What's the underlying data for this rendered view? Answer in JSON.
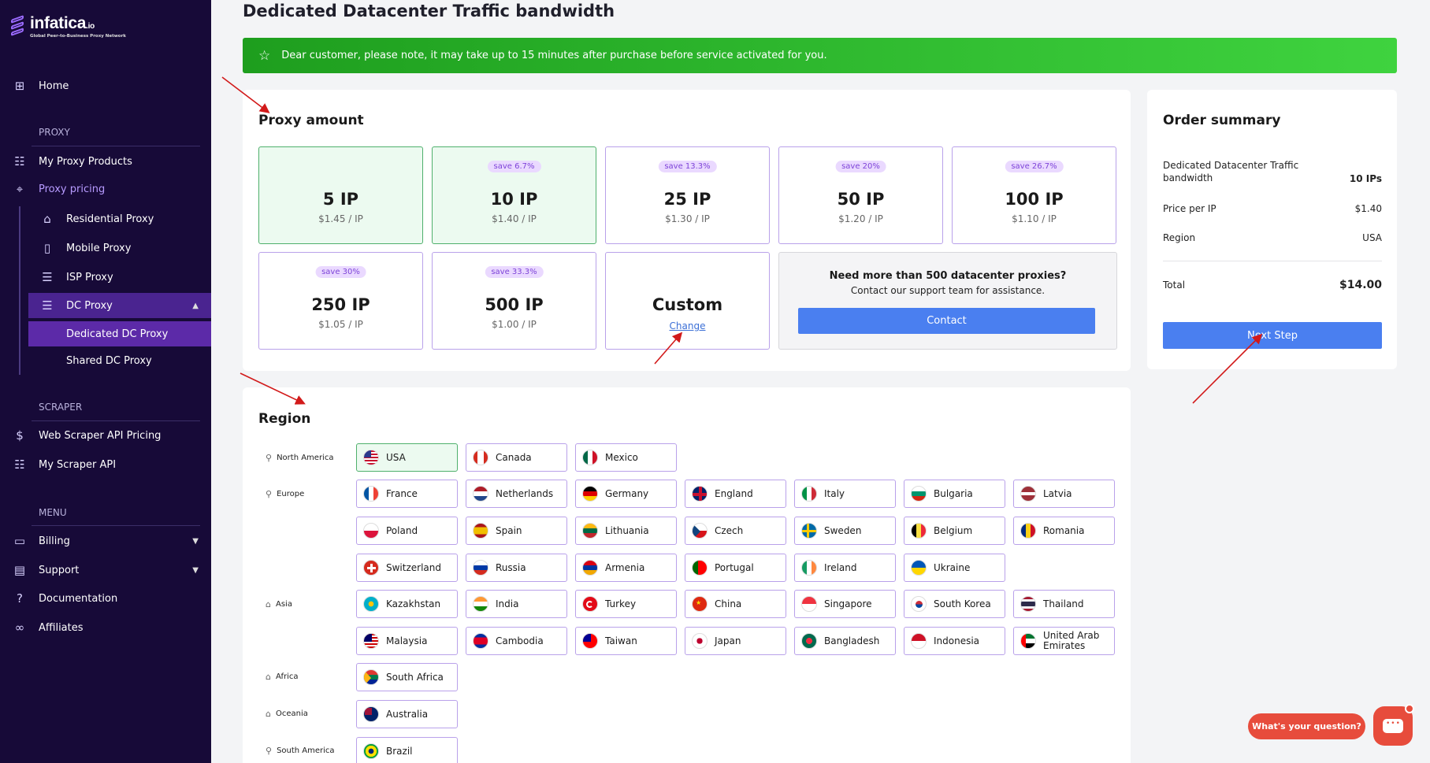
{
  "sidebar": {
    "logo": {
      "brand": "infatica",
      "tld": ".io",
      "tagline": "Global Peer-to-Business Proxy Network"
    },
    "home": {
      "label": "Home",
      "icon": "dashboard-icon"
    },
    "proxy_section": "PROXY",
    "my_proxy_products": {
      "label": "My Proxy Products",
      "icon": "list-icon"
    },
    "proxy_pricing": {
      "label": "Proxy pricing",
      "icon": "tag-icon"
    },
    "residential": {
      "label": "Residential Proxy",
      "icon": "house-icon"
    },
    "mobile": {
      "label": "Mobile Proxy",
      "icon": "mobile-icon"
    },
    "isp": {
      "label": "ISP Proxy",
      "icon": "server-icon"
    },
    "dc": {
      "label": "DC Proxy",
      "icon": "server-icon"
    },
    "dedicated_dc": {
      "label": "Dedicated DC Proxy"
    },
    "shared_dc": {
      "label": "Shared DC Proxy"
    },
    "scraper_section": "SCRAPER",
    "web_scraper": {
      "label": "Web Scraper API Pricing",
      "icon": "dollar-icon"
    },
    "my_scraper": {
      "label": "My Scraper API",
      "icon": "list-icon"
    },
    "menu_section": "MENU",
    "billing": {
      "label": "Billing",
      "icon": "card-icon"
    },
    "support": {
      "label": "Support",
      "icon": "chat-icon"
    },
    "documentation": {
      "label": "Documentation",
      "icon": "question-icon"
    },
    "affiliates": {
      "label": "Affiliates",
      "icon": "link-icon"
    }
  },
  "page": {
    "title": "Dedicated Datacenter Traffic bandwidth",
    "notice": "Dear customer, please note, it may take up to 15 minutes after purchase before service activated for you."
  },
  "proxy_amount": {
    "title": "Proxy amount",
    "options": [
      {
        "amount": "5 IP",
        "price": "$1.45 / IP",
        "save": ""
      },
      {
        "amount": "10 IP",
        "price": "$1.40 / IP",
        "save": "save 6.7%"
      },
      {
        "amount": "25 IP",
        "price": "$1.30 / IP",
        "save": "save 13.3%"
      },
      {
        "amount": "50 IP",
        "price": "$1.20 / IP",
        "save": "save 20%"
      },
      {
        "amount": "100 IP",
        "price": "$1.10 / IP",
        "save": "save 26.7%"
      },
      {
        "amount": "250 IP",
        "price": "$1.05 / IP",
        "save": "save 30%"
      },
      {
        "amount": "500 IP",
        "price": "$1.00 / IP",
        "save": "save 33.3%"
      }
    ],
    "custom": {
      "label": "Custom",
      "change": "Change"
    },
    "support": {
      "heading": "Need more than 500 datacenter proxies?",
      "text": "Contact our support team for assistance.",
      "button": "Contact"
    }
  },
  "region": {
    "title": "Region",
    "groups": {
      "north_america": "North America",
      "europe": "Europe",
      "asia": "Asia",
      "africa": "Africa",
      "oceania": "Oceania",
      "south_america": "South America"
    },
    "countries": {
      "usa": "USA",
      "canada": "Canada",
      "mexico": "Mexico",
      "france": "France",
      "netherlands": "Netherlands",
      "germany": "Germany",
      "england": "England",
      "italy": "Italy",
      "bulgaria": "Bulgaria",
      "latvia": "Latvia",
      "poland": "Poland",
      "spain": "Spain",
      "lithuania": "Lithuania",
      "czech": "Czech",
      "sweden": "Sweden",
      "belgium": "Belgium",
      "romania": "Romania",
      "switzerland": "Switzerland",
      "russia": "Russia",
      "armenia": "Armenia",
      "portugal": "Portugal",
      "ireland": "Ireland",
      "ukraine": "Ukraine",
      "kazakhstan": "Kazakhstan",
      "india": "India",
      "turkey": "Turkey",
      "china": "China",
      "singapore": "Singapore",
      "south_korea": "South Korea",
      "thailand": "Thailand",
      "malaysia": "Malaysia",
      "cambodia": "Cambodia",
      "taiwan": "Taiwan",
      "japan": "Japan",
      "bangladesh": "Bangladesh",
      "indonesia": "Indonesia",
      "uae": "United Arab Emirates",
      "south_africa": "South Africa",
      "australia": "Australia",
      "brazil": "Brazil"
    }
  },
  "order_summary": {
    "title": "Order summary",
    "product_label": "Dedicated Datacenter Traffic bandwidth",
    "product_value": "10 IPs",
    "price_label": "Price per IP",
    "price_value": "$1.40",
    "region_label": "Region",
    "region_value": "USA",
    "total_label": "Total",
    "total_value": "$14.00",
    "next_button": "Next Step"
  },
  "chat": {
    "bubble": "What's your question?"
  },
  "colors": {
    "sidebar_bg": "#170a38",
    "accent_purple": "#b9a1ea",
    "selected_green": "#ecfaf0",
    "button_blue": "#4a7ff0",
    "notice_green": "#2fb82f",
    "chat_red": "#e74c3c",
    "annotation_red": "#d21a1a"
  }
}
